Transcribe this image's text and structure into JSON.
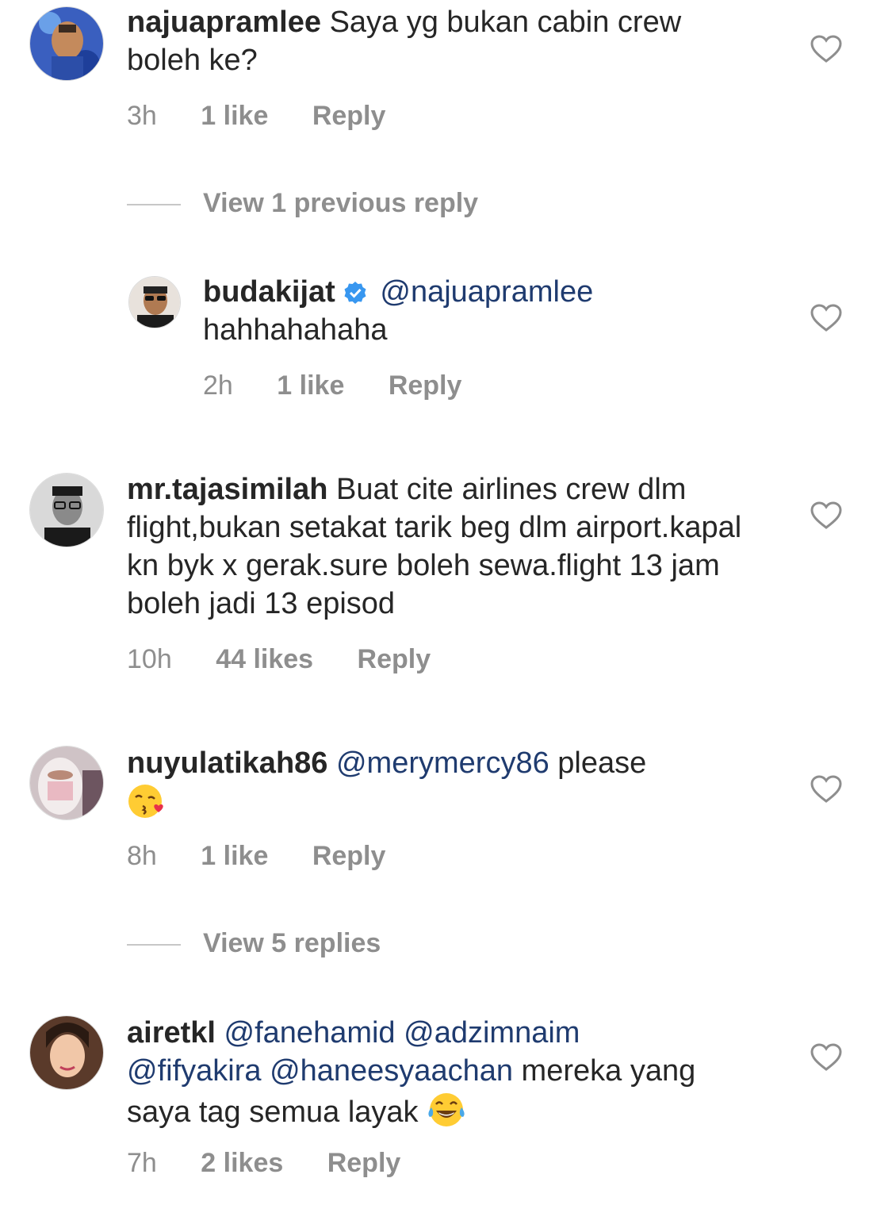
{
  "comments": [
    {
      "username": "najuapramlee",
      "text": "Saya yg bukan cabin crew boleh ke?",
      "time": "3h",
      "likes": "1 like",
      "reply": "Reply"
    },
    {
      "view_replies": "View 1 previous reply"
    },
    {
      "username": "budakijat",
      "mention": "@najuapramlee",
      "text": "hahhahahaha",
      "time": "2h",
      "likes": "1 like",
      "reply": "Reply"
    },
    {
      "username": "mr.tajasimilah",
      "text": "Buat cite airlines crew dlm flight,bukan setakat tarik beg dlm airport.kapal kn byk x gerak.sure boleh sewa.flight 13 jam boleh jadi 13 episod",
      "time": "10h",
      "likes": "44 likes",
      "reply": "Reply"
    },
    {
      "username": "nuyulatikah86",
      "mention": "@merymercy86",
      "text": "please",
      "emoji": "kissing-face-heart",
      "time": "8h",
      "likes": "1 like",
      "reply": "Reply"
    },
    {
      "view_replies": "View 5 replies"
    },
    {
      "username": "airetkl",
      "mentions": [
        "@fanehamid",
        "@adzimnaim",
        "@fifyakira",
        "@haneesyaachan"
      ],
      "text": "mereka yang saya tag semua layak",
      "emoji": "tears-of-joy",
      "time": "7h",
      "likes": "2 likes",
      "reply": "Reply"
    }
  ],
  "colors": {
    "mention": "#1f3b6f",
    "meta": "#8e8e8e",
    "verified": "#3897f0"
  }
}
